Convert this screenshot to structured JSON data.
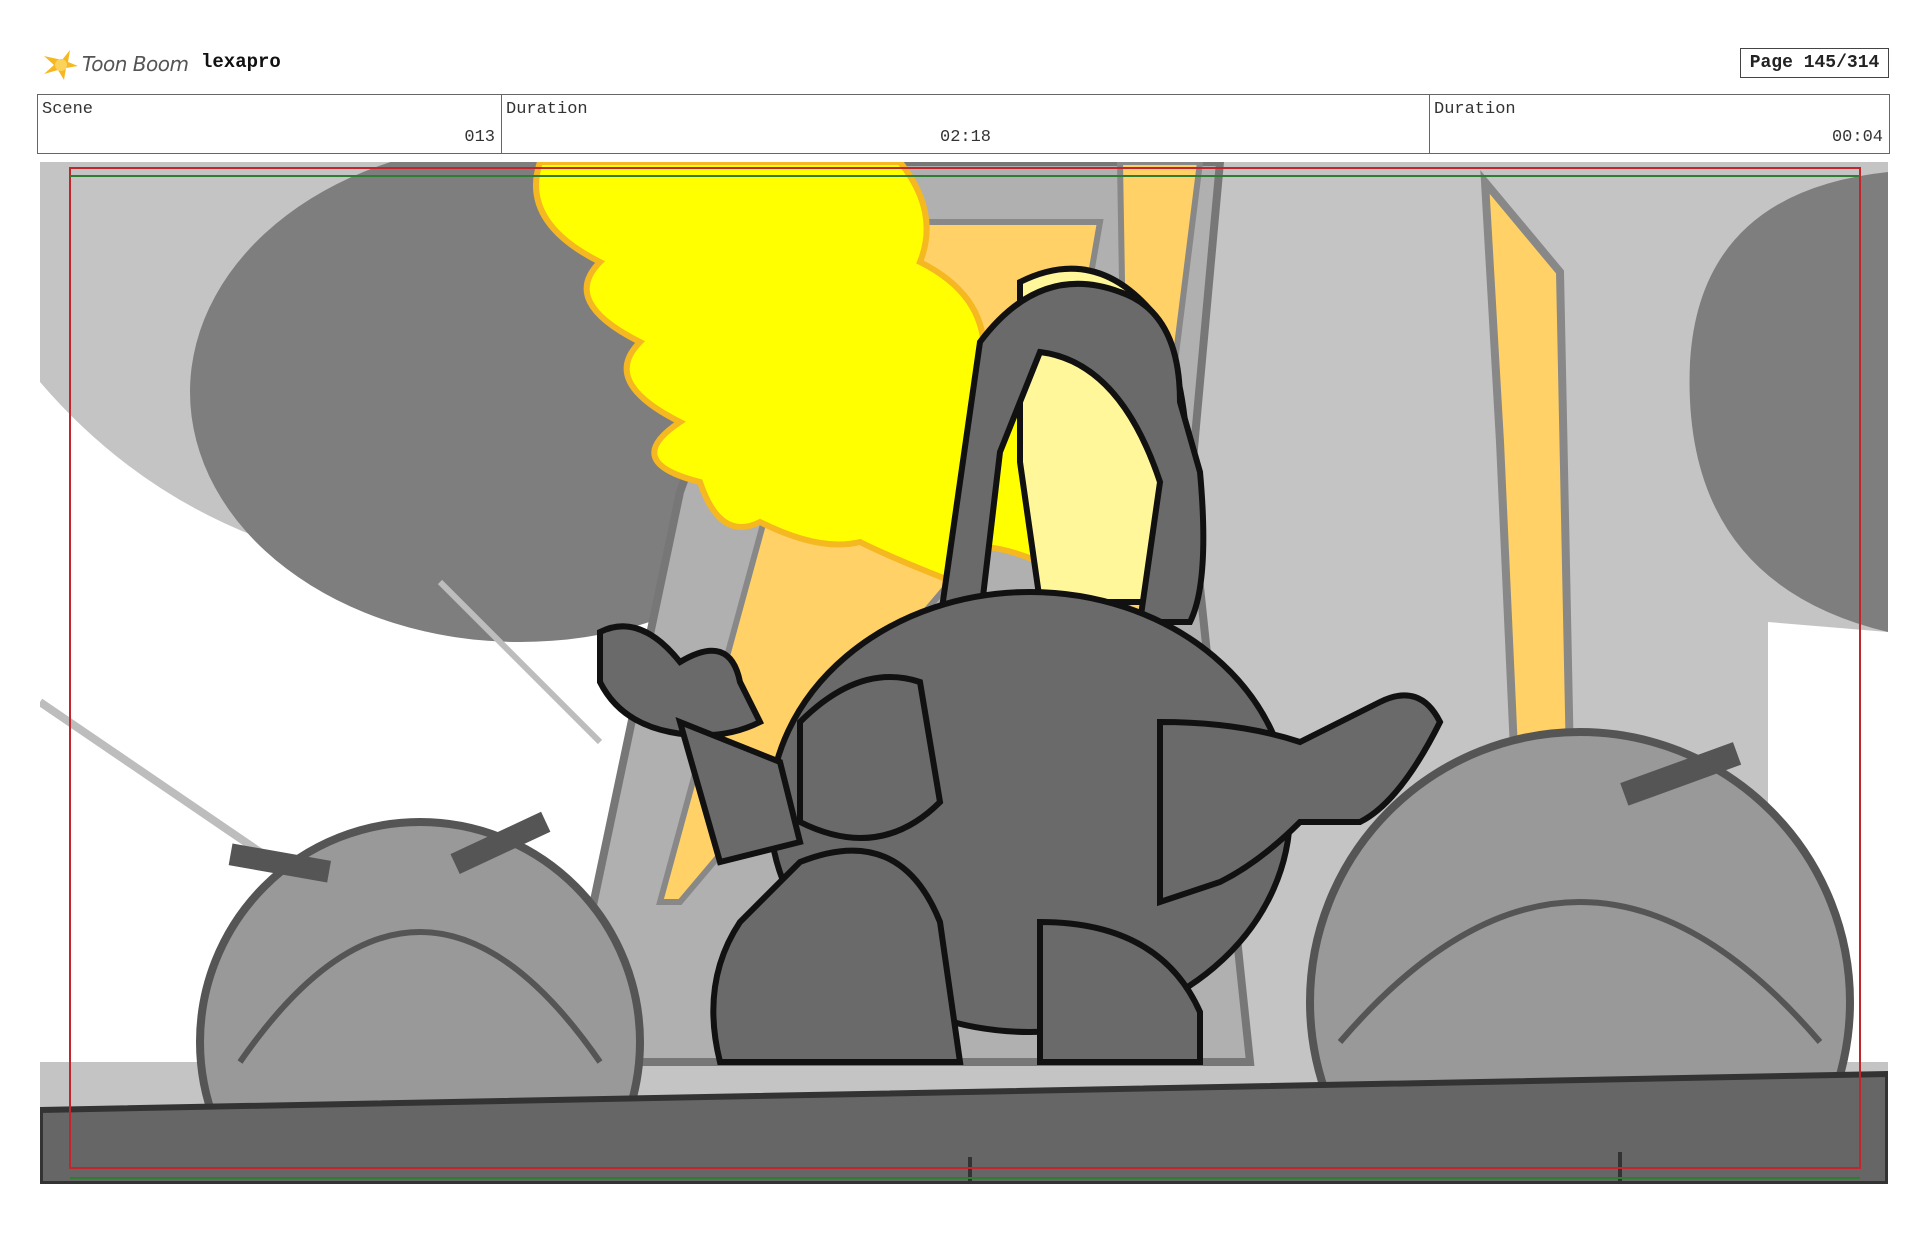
{
  "header": {
    "logo_text": "Toon Boom",
    "project_name": "lexapro",
    "page_indicator": "Page 145/314"
  },
  "info_table": {
    "scene_label": "Scene",
    "scene_value": "013",
    "duration_label": "Duration",
    "duration_value": "02:18",
    "panel_duration_label": "Duration",
    "panel_duration_value": "00:04"
  },
  "colors": {
    "brand_yellow": "#f5b820",
    "safe_frame_red": "#c0262c",
    "action_frame_green": "#2e7d32",
    "flame_yellow": "#ffff00",
    "flame_outline": "#f5b820",
    "pillar_orange": "#ffd166"
  }
}
